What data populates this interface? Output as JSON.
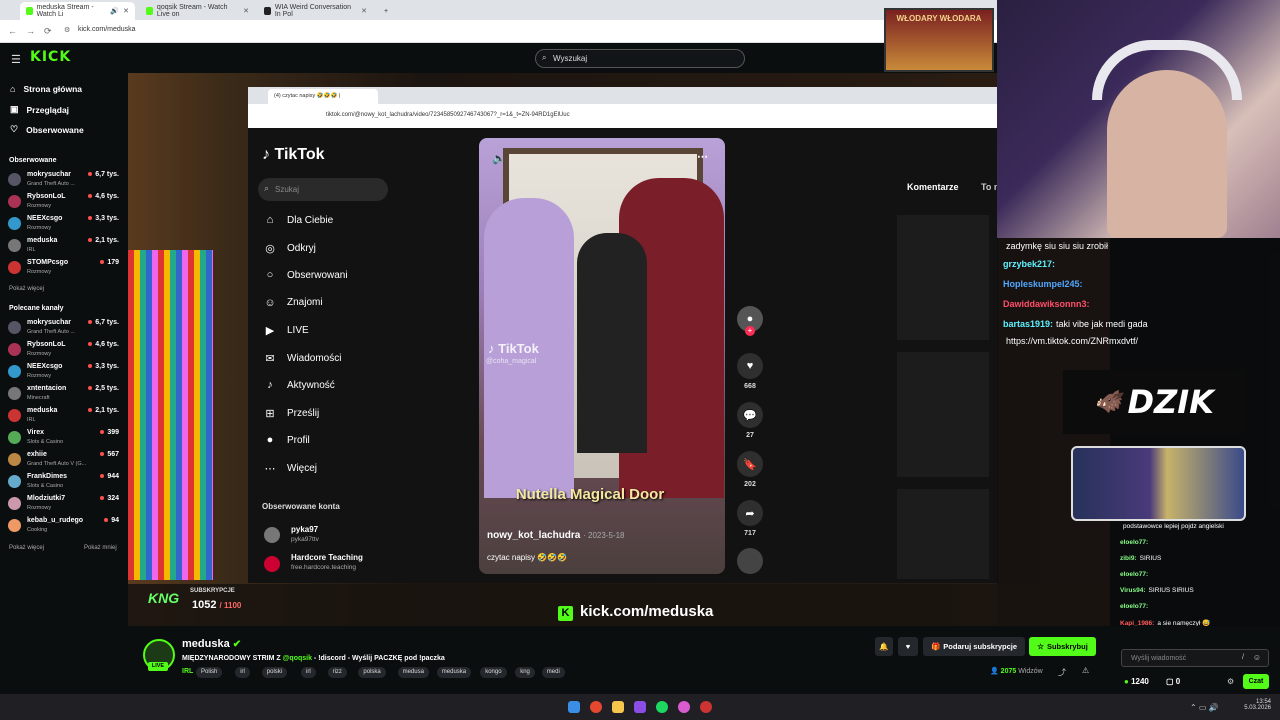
{
  "browser": {
    "tabs": [
      {
        "label": "meduska Stream - Watch Li"
      },
      {
        "label": "qoqsik Stream - Watch Live on"
      },
      {
        "label": "WIA Weird Conversation In Pol"
      }
    ],
    "url": "kick.com/meduska"
  },
  "header": {
    "logo": "KICK",
    "search_placeholder": "Wyszukaj"
  },
  "sidebar": {
    "nav": [
      {
        "label": "Strona główna",
        "icon": "home-icon"
      },
      {
        "label": "Przeglądaj",
        "icon": "browse-icon"
      },
      {
        "label": "Obserwowane",
        "icon": "heart-icon"
      }
    ],
    "followed_title": "Obserwowane",
    "followed": [
      {
        "name": "mokrysuchar",
        "category": "Grand Theft Auto ...",
        "viewers": "6,7 tys."
      },
      {
        "name": "RybsonLoL",
        "category": "Rozmowy",
        "viewers": "4,6 tys."
      },
      {
        "name": "NEEXcsgo",
        "category": "Rozmowy",
        "viewers": "3,3 tys."
      },
      {
        "name": "meduska",
        "category": "IRL",
        "viewers": "2,1 tys."
      },
      {
        "name": "STOMPcsgo",
        "category": "Rozmowy",
        "viewers": "179"
      }
    ],
    "show_more": "Pokaż więcej",
    "recommended_title": "Polecane kanały",
    "recommended": [
      {
        "name": "mokrysuchar",
        "category": "Grand Theft Auto ...",
        "viewers": "6,7 tys."
      },
      {
        "name": "RybsonLoL",
        "category": "Rozmowy",
        "viewers": "4,6 tys."
      },
      {
        "name": "NEEXcsgo",
        "category": "Rozmowy",
        "viewers": "3,3 tys."
      },
      {
        "name": "xntentacion",
        "category": "Minecraft",
        "viewers": "2,5 tys."
      },
      {
        "name": "meduska",
        "category": "IRL",
        "viewers": "2,1 tys."
      },
      {
        "name": "Virex",
        "category": "Slots & Casino",
        "viewers": "399"
      },
      {
        "name": "exhiie",
        "category": "Grand Theft Auto V (G...",
        "viewers": "567"
      },
      {
        "name": "FrankDimes",
        "category": "Slots & Casino",
        "viewers": "944"
      },
      {
        "name": "Mlodziutki7",
        "category": "Rozmowy",
        "viewers": "324"
      },
      {
        "name": "kebab_u_rudego",
        "category": "Cooking",
        "viewers": "94"
      }
    ],
    "show_more2": "Pokaż więcej",
    "show_less": "Pokaż mniej"
  },
  "inner_browser": {
    "tab_label": "(4) czytac napisy 🤣🤣🤣 |",
    "url": "tiktok.com/@nowy_kot_lachudra/video/7234585092746743067?_r=1&_t=ZN-94RD1gElUuc"
  },
  "tiktok": {
    "logo": "TikTok",
    "search_placeholder": "Szukaj",
    "nav": [
      {
        "label": "Dla Ciebie",
        "icon": "home-icon"
      },
      {
        "label": "Odkryj",
        "icon": "compass-icon"
      },
      {
        "label": "Obserwowani",
        "icon": "following-icon"
      },
      {
        "label": "Znajomi",
        "icon": "friends-icon"
      },
      {
        "label": "LIVE",
        "icon": "live-icon"
      },
      {
        "label": "Wiadomości",
        "icon": "message-icon"
      },
      {
        "label": "Aktywność",
        "icon": "activity-icon"
      },
      {
        "label": "Prześlij",
        "icon": "upload-icon"
      },
      {
        "label": "Profil",
        "icon": "profile-icon"
      },
      {
        "label": "Więcej",
        "icon": "more-icon"
      }
    ],
    "followed_accounts_title": "Obserwowane konta",
    "accounts": [
      {
        "name": "pyka97",
        "handle": "pyka97ttv"
      },
      {
        "name": "Hardcore Teaching",
        "handle": "free.hardcore.teaching"
      }
    ],
    "video": {
      "watermark": "TikTok",
      "watermark_handle": "@coha_magical",
      "caption_overlay": "Nutella Magical Door",
      "author": "nowy_kot_lachudra",
      "date": "· 2023-5-18",
      "description": "czytac napisy 🤣🤣🤣"
    },
    "actions": [
      {
        "icon": "heart-icon",
        "count": "668"
      },
      {
        "icon": "comment-icon",
        "count": "27"
      },
      {
        "icon": "bookmark-icon",
        "count": "202"
      },
      {
        "icon": "share-icon",
        "count": "717"
      }
    ],
    "comments_tab": "Komentarze",
    "comments_tab2": "To n"
  },
  "overlay_chat": [
    {
      "user": "",
      "text": "zadymkę siu siu siu zrobił"
    },
    {
      "user": "grzybek217:",
      "text": ""
    },
    {
      "user": "Hopleskumpel245:",
      "text": ""
    },
    {
      "user": "Dawiddawiksonnn3:",
      "text": ""
    },
    {
      "user": "bartas1919:",
      "text": "taki vibe jak medi gada"
    },
    {
      "user": "",
      "text": "https://vm.tiktok.com/ZNRmxdvtf/"
    }
  ],
  "overlay_side_chat": [
    {
      "user": "",
      "text": "podstawowce lepiej pojdz angielski"
    },
    {
      "user": "eloelo77:",
      "text": ""
    },
    {
      "user": "zibi9:",
      "text": "SIRIUS"
    },
    {
      "user": "eloelo77:",
      "text": ""
    },
    {
      "user": "Virus94:",
      "text": "SIRIUS SIRIUS"
    },
    {
      "user": "eloelo77:",
      "text": ""
    },
    {
      "user": "Kapi_1986:",
      "text": "a sie namęczył 😅"
    }
  ],
  "sponsor": "DZIK",
  "webcam_banner": "WŁODARY WŁODARA",
  "subs_overlay": {
    "label": "SUBSKRYPCJE",
    "value": "1052",
    "goal": "/ 1100",
    "logo": "KNG"
  },
  "kick_link": "kick.com/meduska",
  "stream": {
    "name": "meduska",
    "title_prefix": "MIĘDZYNARODOWY STRIM Z ",
    "title_mention": "@qoqsik",
    "title_suffix": " - !discord - Wyślij PACZKĘ pod !paczka",
    "category": "IRL",
    "tags": [
      "Polish",
      "irl",
      "polski",
      "irl",
      "rizz",
      "polska",
      "medusa",
      "meduska",
      "kongo",
      "kng",
      "medi"
    ],
    "viewers": "2075",
    "viewers_label": "Widzów",
    "live_badge": "LIVE"
  },
  "buttons": {
    "gift": "Podaruj subskrypcje",
    "subscribe": "Subskrybuj"
  },
  "chat": {
    "placeholder": "Wyślij wiadomość",
    "points": "1240",
    "count": "0",
    "send": "Czat"
  },
  "taskbar": {
    "time": "13:54",
    "date": "5.03.2026"
  },
  "colors": {
    "kick_green": "#53fc18",
    "bg": "#0b0e0f"
  }
}
